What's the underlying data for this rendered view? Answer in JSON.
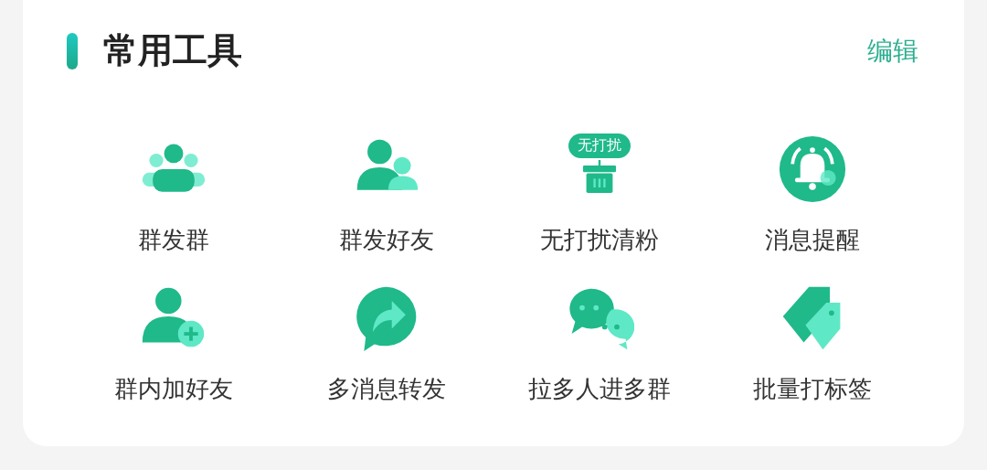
{
  "panel": {
    "title": "常用工具",
    "edit_link": "编辑"
  },
  "tools": [
    {
      "label": "群发群"
    },
    {
      "label": "群发好友"
    },
    {
      "label": "无打扰清粉",
      "badge": "无打扰"
    },
    {
      "label": "消息提醒"
    },
    {
      "label": "群内加好友"
    },
    {
      "label": "多消息转发"
    },
    {
      "label": "拉多人进多群"
    },
    {
      "label": "批量打标签"
    }
  ]
}
